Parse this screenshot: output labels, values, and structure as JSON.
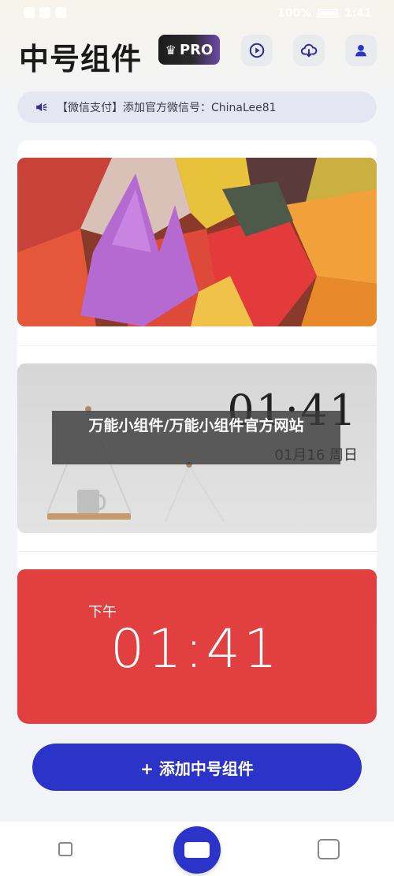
{
  "status_bar": {
    "battery_text": "100%",
    "time": "1:41"
  },
  "header": {
    "title": "中号组件",
    "pro_badge": "PRO",
    "icons": [
      "play-icon",
      "cloud-download-icon",
      "user-icon"
    ]
  },
  "notice": {
    "text": "【微信支付】添加官方微信号：ChinaLee81"
  },
  "widgets": {
    "clock_photo": {
      "time": "01:41",
      "date": "01月16 周日"
    },
    "red_clock": {
      "period": "下午",
      "time": "01:41"
    }
  },
  "overlay": {
    "text": "万能小组件/万能小组件官方网站"
  },
  "add_button": {
    "label": "+ 添加中号组件"
  },
  "colors": {
    "primary": "#2b33c9",
    "red_widget": "#e23f40",
    "notice_bg": "#e4e6f2"
  }
}
